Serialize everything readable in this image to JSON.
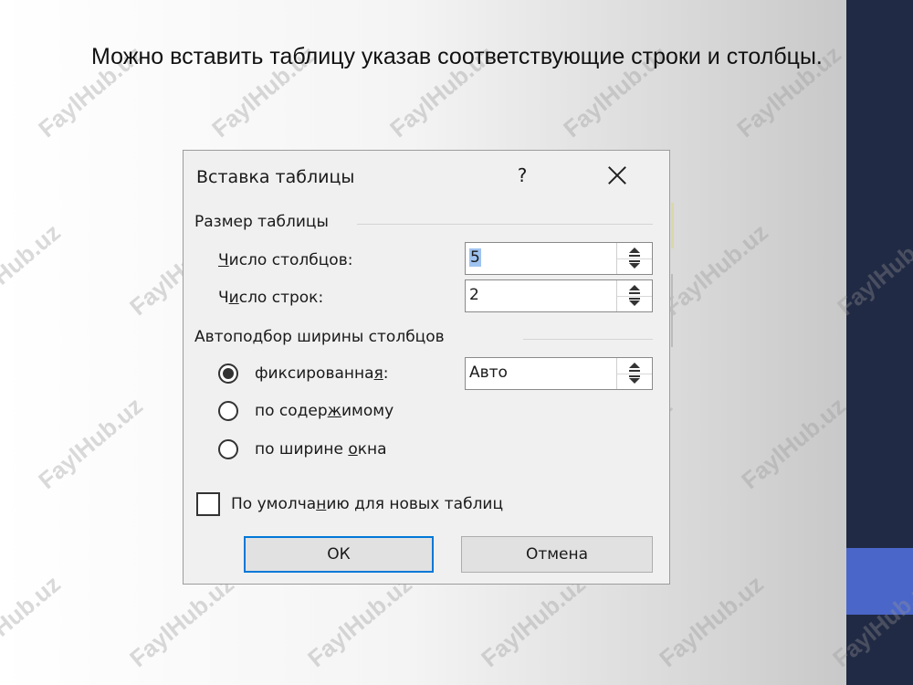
{
  "slide": {
    "text": "Можно вставить таблицу указав соответствующие строки и столбцы."
  },
  "watermark": "FaylHub.uz",
  "colors": {
    "sidebar": "#212a44",
    "accent": "#4a66c9",
    "ok_focus": "#0078d7"
  },
  "dialog": {
    "title": "Вставка таблицы",
    "help": "?",
    "size_group": "Размер таблицы",
    "columns_label_pre": "",
    "columns_label_u": "Ч",
    "columns_label_post": "исло столбцов:",
    "columns_value": "5",
    "rows_label_pre": "Ч",
    "rows_label_u": "и",
    "rows_label_post": "сло строк:",
    "rows_value": "2",
    "autofit_group": "Автоподбор ширины столбцов",
    "radio_fixed_pre": "фиксированна",
    "radio_fixed_u": "я",
    "radio_fixed_post": ":",
    "fixed_value": "Авто",
    "radio_content_pre": "по содер",
    "radio_content_u": "ж",
    "radio_content_post": "имому",
    "radio_window_pre": "по ширине ",
    "radio_window_u": "о",
    "radio_window_post": "кна",
    "default_pre": "По умолча",
    "default_u": "н",
    "default_post": "ию для новых таблиц",
    "ok": "ОК",
    "cancel": "Отмена"
  }
}
